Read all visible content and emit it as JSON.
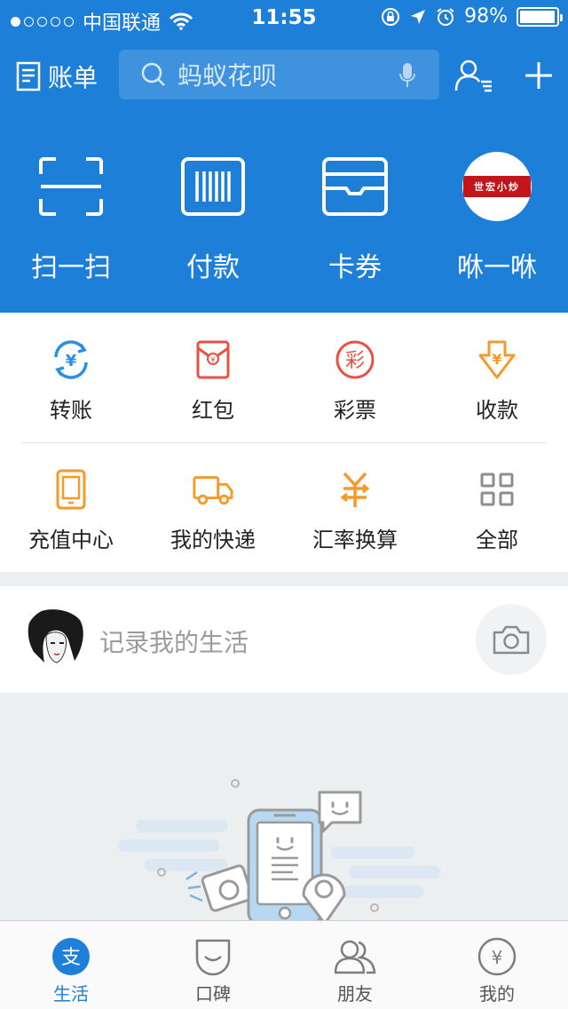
{
  "status_bar": {
    "carrier": "中国联通",
    "time": "11:55",
    "battery": "98%",
    "battery_level": 0.98
  },
  "navbar": {
    "bill_label": "账单",
    "search_placeholder": "蚂蚁花呗"
  },
  "quick_actions": [
    {
      "label": "扫一扫",
      "icon": "scan-icon"
    },
    {
      "label": "付款",
      "icon": "barcode-icon"
    },
    {
      "label": "卡券",
      "icon": "wallet-icon"
    },
    {
      "label": "咻一咻",
      "icon": "brand-logo",
      "brand_text": "世宏小炒"
    }
  ],
  "grid": {
    "row1": [
      {
        "label": "转账",
        "icon": "transfer-icon",
        "color": "#2b8fe6"
      },
      {
        "label": "红包",
        "icon": "red-envelope-icon",
        "color": "#e8513f"
      },
      {
        "label": "彩票",
        "icon": "lottery-icon",
        "color": "#e8513f",
        "glyph": "彩"
      },
      {
        "label": "收款",
        "icon": "receive-money-icon",
        "color": "#f49a2a"
      }
    ],
    "row2": [
      {
        "label": "充值中心",
        "icon": "phone-recharge-icon",
        "color": "#f49a2a"
      },
      {
        "label": "我的快递",
        "icon": "truck-icon",
        "color": "#f49a2a"
      },
      {
        "label": "汇率换算",
        "icon": "exchange-rate-icon",
        "color": "#f49a2a"
      },
      {
        "label": "全部",
        "icon": "grid-all-icon",
        "color": "#8e8e8e"
      }
    ]
  },
  "life": {
    "placeholder": "记录我的生活"
  },
  "tabbar": [
    {
      "label": "生活",
      "icon": "alipay-icon",
      "active": true
    },
    {
      "label": "口碑",
      "icon": "koubei-icon",
      "active": false
    },
    {
      "label": "朋友",
      "icon": "friends-icon",
      "active": false
    },
    {
      "label": "我的",
      "icon": "yuan-icon",
      "active": false
    }
  ],
  "colors": {
    "brand_blue": "#1e7fd8",
    "red": "#e8513f",
    "orange": "#f49a2a",
    "gray": "#8e8e8e"
  }
}
